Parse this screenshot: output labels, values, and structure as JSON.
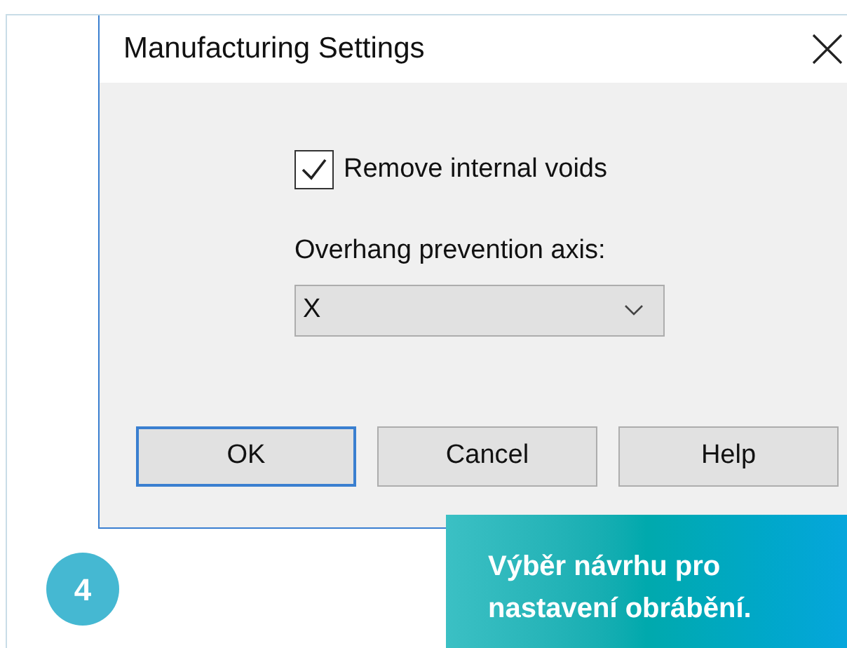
{
  "dialog": {
    "title": "Manufacturing Settings",
    "checkbox": {
      "label": "Remove internal voids",
      "checked": true
    },
    "axis": {
      "label": "Overhang prevention axis:",
      "value": "X"
    },
    "buttons": [
      {
        "label": "OK",
        "default": true
      },
      {
        "label": "Cancel",
        "default": false
      },
      {
        "label": "Help",
        "default": false
      }
    ]
  },
  "step": {
    "number": "4"
  },
  "caption": {
    "lines": [
      "Výběr návrhu pro",
      "nastavení obrábění."
    ]
  }
}
